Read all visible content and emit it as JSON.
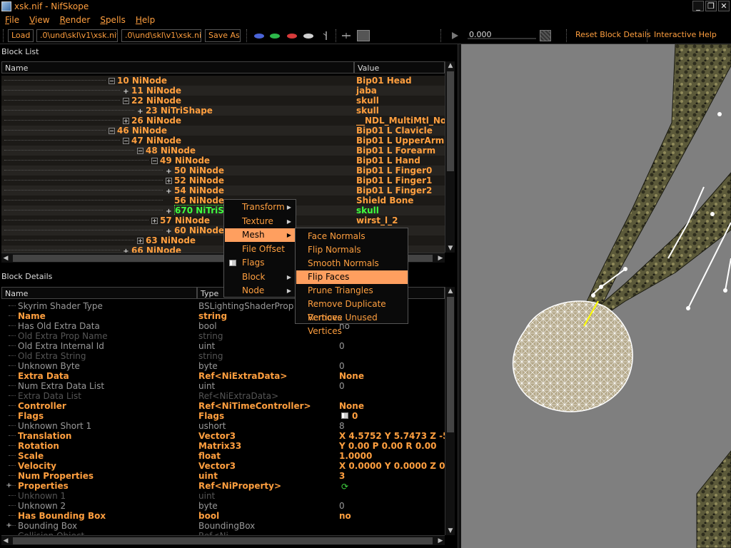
{
  "window": {
    "title": "xsk.nif - NifSkope"
  },
  "menubar": {
    "items": [
      {
        "first": "F",
        "rest": "ile"
      },
      {
        "first": "V",
        "rest": "iew"
      },
      {
        "first": "R",
        "rest": "ender"
      },
      {
        "first": "S",
        "rest": "pells"
      },
      {
        "first": "H",
        "rest": "elp"
      }
    ]
  },
  "toolbar": {
    "load_label": "Load",
    "load_path": ".0\\und\\skl\\v1\\xsk.nif",
    "save_path": ".0\\und\\skl\\v1\\xsk.nif",
    "save_label": "Save As",
    "anim_time": "0.000",
    "reset_label": "Reset Block Details",
    "help_label": "Interactive Help"
  },
  "block_list": {
    "title": "Block List",
    "col_name": "Name",
    "col_value": "Value",
    "rows": [
      {
        "name": "10 NiNode",
        "value": "Bip01 Head"
      },
      {
        "name": "11 NiNode",
        "value": "jaba"
      },
      {
        "name": "22 NiNode",
        "value": "skull"
      },
      {
        "name": "23 NiTriShape",
        "value": "skull"
      },
      {
        "name": "26 NiNode",
        "value": "__NDL_MultiMtl_No"
      },
      {
        "name": "46 NiNode",
        "value": "Bip01 L Clavicle"
      },
      {
        "name": "47 NiNode",
        "value": "Bip01 L UpperArm"
      },
      {
        "name": "48 NiNode",
        "value": "Bip01 L Forearm"
      },
      {
        "name": "49 NiNode",
        "value": "Bip01 L Hand"
      },
      {
        "name": "50 NiNode",
        "value": "Bip01 L Finger0"
      },
      {
        "name": "52 NiNode",
        "value": "Bip01 L Finger1"
      },
      {
        "name": "54 NiNode",
        "value": "Bip01 L Finger2"
      },
      {
        "name": "56 NiNode",
        "value": "Shield Bone"
      },
      {
        "name": "670 NiTriSh",
        "value": "skull"
      },
      {
        "name": "57 NiNode",
        "value": "wirst_l_2"
      },
      {
        "name": "60 NiNode",
        "value": ""
      },
      {
        "name": "63 NiNode",
        "value": ""
      },
      {
        "name": "66 NiNode",
        "value": ""
      }
    ]
  },
  "block_details": {
    "title": "Block Details",
    "col_name": "Name",
    "col_type": "Type",
    "rows": [
      {
        "name": "Skyrim Shader Type",
        "type": "BSLightingShaderProp",
        "value": ""
      },
      {
        "name": "Name",
        "type": "string",
        "value": ""
      },
      {
        "name": "Has Old Extra Data",
        "type": "bool",
        "value": "no"
      },
      {
        "name": "Old Extra Prop Name",
        "type": "string",
        "value": ""
      },
      {
        "name": "Old Extra Internal Id",
        "type": "uint",
        "value": "0"
      },
      {
        "name": "Old Extra String",
        "type": "string",
        "value": ""
      },
      {
        "name": "Unknown Byte",
        "type": "byte",
        "value": "0"
      },
      {
        "name": "Extra Data",
        "type": "Ref<NiExtraData>",
        "value": "None"
      },
      {
        "name": "Num Extra Data List",
        "type": "uint",
        "value": "0"
      },
      {
        "name": "Extra Data List",
        "type": "Ref<NiExtraData>",
        "value": ""
      },
      {
        "name": "Controller",
        "type": "Ref<NiTimeController>",
        "value": "None"
      },
      {
        "name": "Flags",
        "type": "Flags",
        "value": "0"
      },
      {
        "name": "Unknown Short 1",
        "type": "ushort",
        "value": "8"
      },
      {
        "name": "Translation",
        "type": "Vector3",
        "value": "X 4.5752 Y 5.7473 Z -5."
      },
      {
        "name": "Rotation",
        "type": "Matrix33",
        "value": "Y 0.00 P 0.00 R 0.00"
      },
      {
        "name": "Scale",
        "type": "float",
        "value": "1.0000"
      },
      {
        "name": "Velocity",
        "type": "Vector3",
        "value": "X 0.0000 Y 0.0000 Z 0.0"
      },
      {
        "name": "Num Properties",
        "type": "uint",
        "value": "3"
      },
      {
        "name": "Properties",
        "type": "Ref<NiProperty>",
        "value": ""
      },
      {
        "name": "Unknown 1",
        "type": "uint",
        "value": ""
      },
      {
        "name": "Unknown 2",
        "type": "byte",
        "value": "0"
      },
      {
        "name": "Has Bounding Box",
        "type": "bool",
        "value": "no"
      },
      {
        "name": "Bounding Box",
        "type": "BoundingBox",
        "value": ""
      },
      {
        "name": "Collision Object",
        "type": "Ref<Ni",
        "value": ""
      }
    ]
  },
  "context_menu": {
    "items": [
      "Transform",
      "Texture",
      "Mesh",
      "File Offset",
      "Flags",
      "Block",
      "Node"
    ]
  },
  "mesh_submenu": {
    "items": [
      "Face Normals",
      "Flip Normals",
      "Smooth Normals",
      "Flip Faces",
      "Prune Triangles",
      "Remove Duplicate Vertices",
      "Remove Unused Vertices"
    ]
  },
  "colors": {
    "accent": "#ff9f3f",
    "highlight": "#ff9f5f",
    "selected_text": "#3fff3f",
    "viewport_bg": "#7f7f7f"
  }
}
